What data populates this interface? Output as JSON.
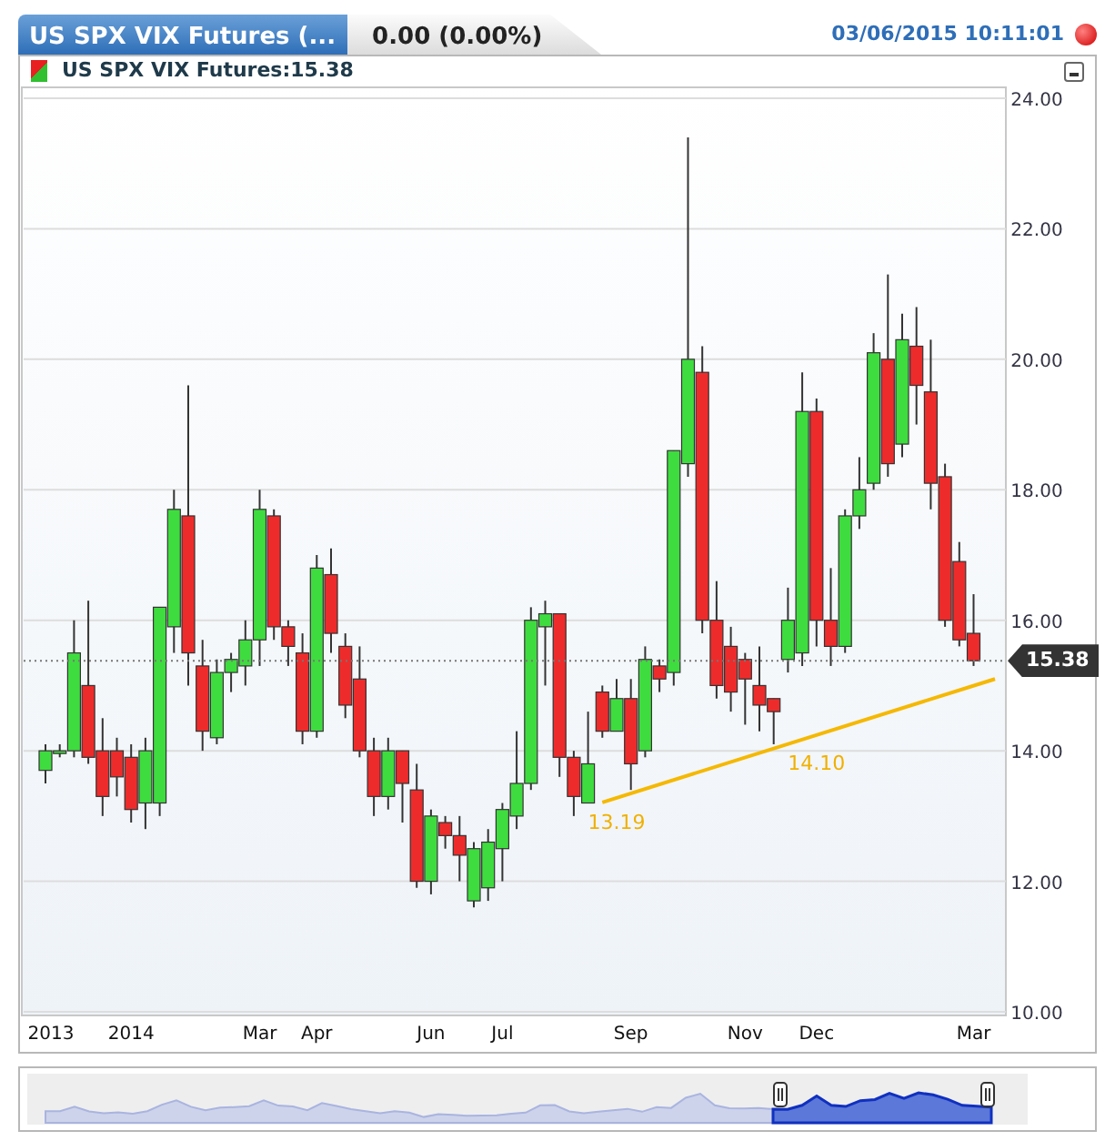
{
  "header": {
    "tab_title": "US SPX VIX Futures (...",
    "change": "0.00 (0.00%)",
    "timestamp": "03/06/2015 10:11:01"
  },
  "chart": {
    "legend": "US SPX VIX Futures:15.38",
    "last_price": "15.38",
    "chart_data": {
      "type": "candlestick",
      "categories": [
        "2013",
        null,
        null,
        null,
        null,
        null,
        "2014",
        null,
        null,
        null,
        null,
        null,
        null,
        null,
        null,
        "Mar",
        null,
        null,
        null,
        "Apr",
        null,
        null,
        null,
        null,
        null,
        null,
        null,
        "Jun",
        null,
        null,
        null,
        null,
        "Jul",
        null,
        null,
        null,
        null,
        null,
        null,
        null,
        null,
        "Sep",
        null,
        null,
        null,
        null,
        null,
        null,
        null,
        "Nov",
        null,
        null,
        null,
        null,
        "Dec",
        null,
        null,
        null,
        null,
        null,
        null,
        null,
        null,
        null,
        null,
        "Mar"
      ],
      "ohlc": [
        [
          13.7,
          14.1,
          13.5,
          14.0
        ],
        [
          14.0,
          14.1,
          13.9,
          14.0
        ],
        [
          14.0,
          16.0,
          13.9,
          15.5
        ],
        [
          15.0,
          16.3,
          13.8,
          13.9
        ],
        [
          14.0,
          14.5,
          13.0,
          13.3
        ],
        [
          14.0,
          14.2,
          13.3,
          13.6
        ],
        [
          13.9,
          14.1,
          12.9,
          13.1
        ],
        [
          13.2,
          14.2,
          12.8,
          14.0
        ],
        [
          13.2,
          16.2,
          13.0,
          16.2
        ],
        [
          15.9,
          18.0,
          15.5,
          17.7
        ],
        [
          17.6,
          19.6,
          15.0,
          15.5
        ],
        [
          15.3,
          15.7,
          14.0,
          14.3
        ],
        [
          14.2,
          15.4,
          14.1,
          15.2
        ],
        [
          15.2,
          15.5,
          14.9,
          15.4
        ],
        [
          15.3,
          16.0,
          15.0,
          15.7
        ],
        [
          15.7,
          18.0,
          15.3,
          17.7
        ],
        [
          17.6,
          17.7,
          15.7,
          15.9
        ],
        [
          15.9,
          16.0,
          15.3,
          15.6
        ],
        [
          15.5,
          15.8,
          14.1,
          14.3
        ],
        [
          14.3,
          17.0,
          14.2,
          16.8
        ],
        [
          16.7,
          17.1,
          15.5,
          15.8
        ],
        [
          15.6,
          15.8,
          14.5,
          14.7
        ],
        [
          15.1,
          15.6,
          13.9,
          14.0
        ],
        [
          14.0,
          14.2,
          13.0,
          13.3
        ],
        [
          13.3,
          14.2,
          13.1,
          14.0
        ],
        [
          14.0,
          14.0,
          12.9,
          13.5
        ],
        [
          13.4,
          13.8,
          11.9,
          12.0
        ],
        [
          12.0,
          13.1,
          11.8,
          13.0
        ],
        [
          12.9,
          13.0,
          12.5,
          12.7
        ],
        [
          12.7,
          13.0,
          12.0,
          12.4
        ],
        [
          11.7,
          12.6,
          11.6,
          12.5
        ],
        [
          11.9,
          12.8,
          11.7,
          12.6
        ],
        [
          12.5,
          13.2,
          12.0,
          13.1
        ],
        [
          13.0,
          14.3,
          12.8,
          13.5
        ],
        [
          13.5,
          16.2,
          13.4,
          16.0
        ],
        [
          15.9,
          16.3,
          15.0,
          16.1
        ],
        [
          16.1,
          16.1,
          13.6,
          13.9
        ],
        [
          13.9,
          14.0,
          13.0,
          13.3
        ],
        [
          13.2,
          14.6,
          13.2,
          13.8
        ],
        [
          14.9,
          15.0,
          14.2,
          14.3
        ],
        [
          14.3,
          15.1,
          14.3,
          14.8
        ],
        [
          14.8,
          15.1,
          13.4,
          13.8
        ],
        [
          14.0,
          15.6,
          13.9,
          15.4
        ],
        [
          15.3,
          15.4,
          14.9,
          15.1
        ],
        [
          15.2,
          18.6,
          15.0,
          18.6
        ],
        [
          18.4,
          23.4,
          18.2,
          20.0
        ],
        [
          19.8,
          20.2,
          15.8,
          16.0
        ],
        [
          16.0,
          16.6,
          14.8,
          15.0
        ],
        [
          15.6,
          15.9,
          14.6,
          14.9
        ],
        [
          15.4,
          15.5,
          14.4,
          15.1
        ],
        [
          15.0,
          15.6,
          14.3,
          14.7
        ],
        [
          14.8,
          14.8,
          14.1,
          14.6
        ],
        [
          15.4,
          16.5,
          15.2,
          16.0
        ],
        [
          15.5,
          19.8,
          15.3,
          19.2
        ],
        [
          19.2,
          19.4,
          15.6,
          16.0
        ],
        [
          16.0,
          16.8,
          15.3,
          15.6
        ],
        [
          15.6,
          17.7,
          15.5,
          17.6
        ],
        [
          17.6,
          18.5,
          17.4,
          18.0
        ],
        [
          18.1,
          20.4,
          18.0,
          20.1
        ],
        [
          20.0,
          21.3,
          18.2,
          18.4
        ],
        [
          18.7,
          20.7,
          18.5,
          20.3
        ],
        [
          20.2,
          20.8,
          19.0,
          19.6
        ],
        [
          19.5,
          20.3,
          17.7,
          18.1
        ],
        [
          18.2,
          18.4,
          15.9,
          16.0
        ],
        [
          16.9,
          17.2,
          15.6,
          15.7
        ],
        [
          15.8,
          16.4,
          15.3,
          15.38
        ]
      ],
      "yticks": [
        {
          "value": 10,
          "label": "10.00"
        },
        {
          "value": 12,
          "label": "12.00"
        },
        {
          "value": 14,
          "label": "14.00"
        },
        {
          "value": 16,
          "label": "16.00"
        },
        {
          "value": 18,
          "label": "18.00"
        },
        {
          "value": 20,
          "label": "20.00"
        },
        {
          "value": 22,
          "label": "22.00"
        },
        {
          "value": 24,
          "label": "24.00"
        }
      ],
      "ylim": [
        10,
        24
      ],
      "grid": true,
      "ref_lines": [
        {
          "axis": "y",
          "value": 15.38
        }
      ],
      "annotations": [
        "13.19",
        "14.10"
      ]
    }
  }
}
